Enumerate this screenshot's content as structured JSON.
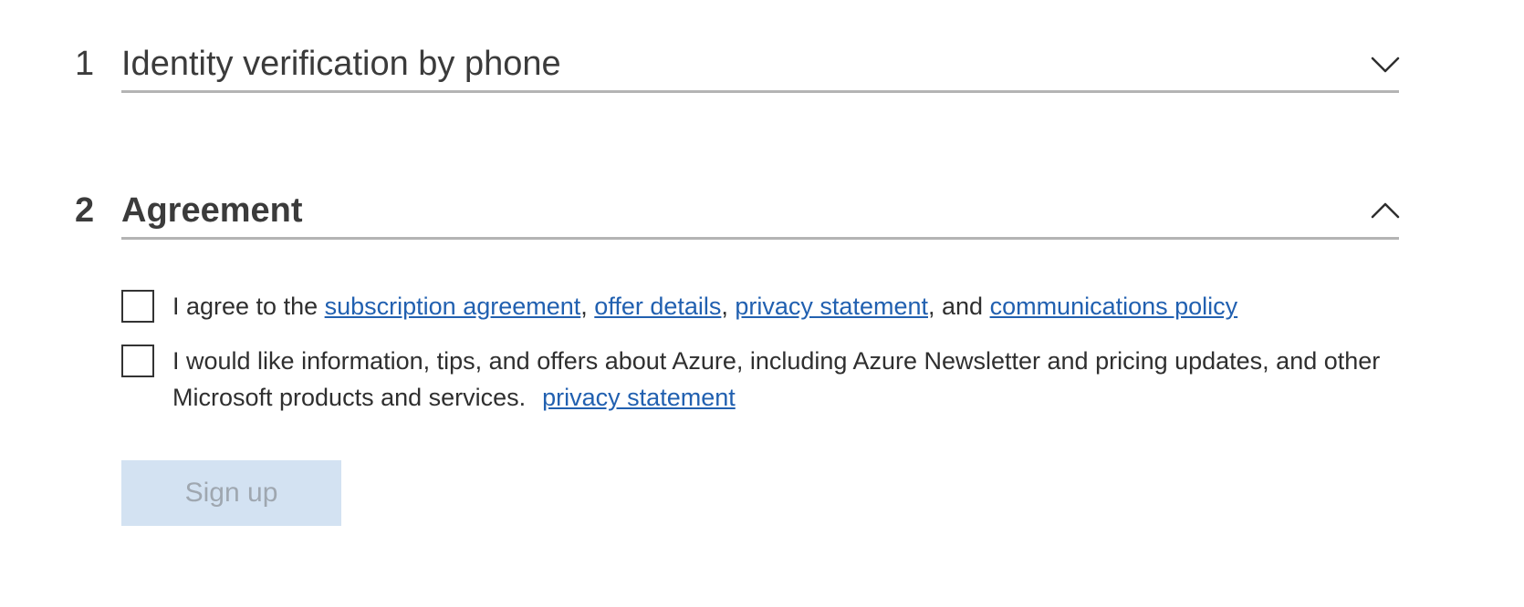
{
  "sections": [
    {
      "number": "1",
      "title": "Identity verification by phone",
      "state": "collapsed",
      "chevron_icon": "chevron-down-icon"
    },
    {
      "number": "2",
      "title": "Agreement",
      "state": "expanded",
      "chevron_icon": "chevron-up-icon"
    }
  ],
  "agreement": {
    "terms": {
      "checked": false,
      "prefix": "I agree to the ",
      "link_subscription": "subscription agreement",
      "sep1": ", ",
      "link_offer": "offer details",
      "sep2": ", ",
      "link_privacy": "privacy statement",
      "sep3": ", and ",
      "link_communications": "communications policy"
    },
    "marketing": {
      "checked": false,
      "text": "I would like information, tips, and offers about Azure, including Azure Newsletter and pricing updates, and other Microsoft products and services.",
      "link_privacy": "privacy statement"
    }
  },
  "signup_button": {
    "label": "Sign up",
    "enabled": false
  },
  "colors": {
    "link": "#2160b0",
    "rule": "#b4b4b4",
    "button_disabled_bg": "#d3e2f2",
    "button_disabled_text": "#9fa7b0",
    "text": "#2f2f2f"
  }
}
